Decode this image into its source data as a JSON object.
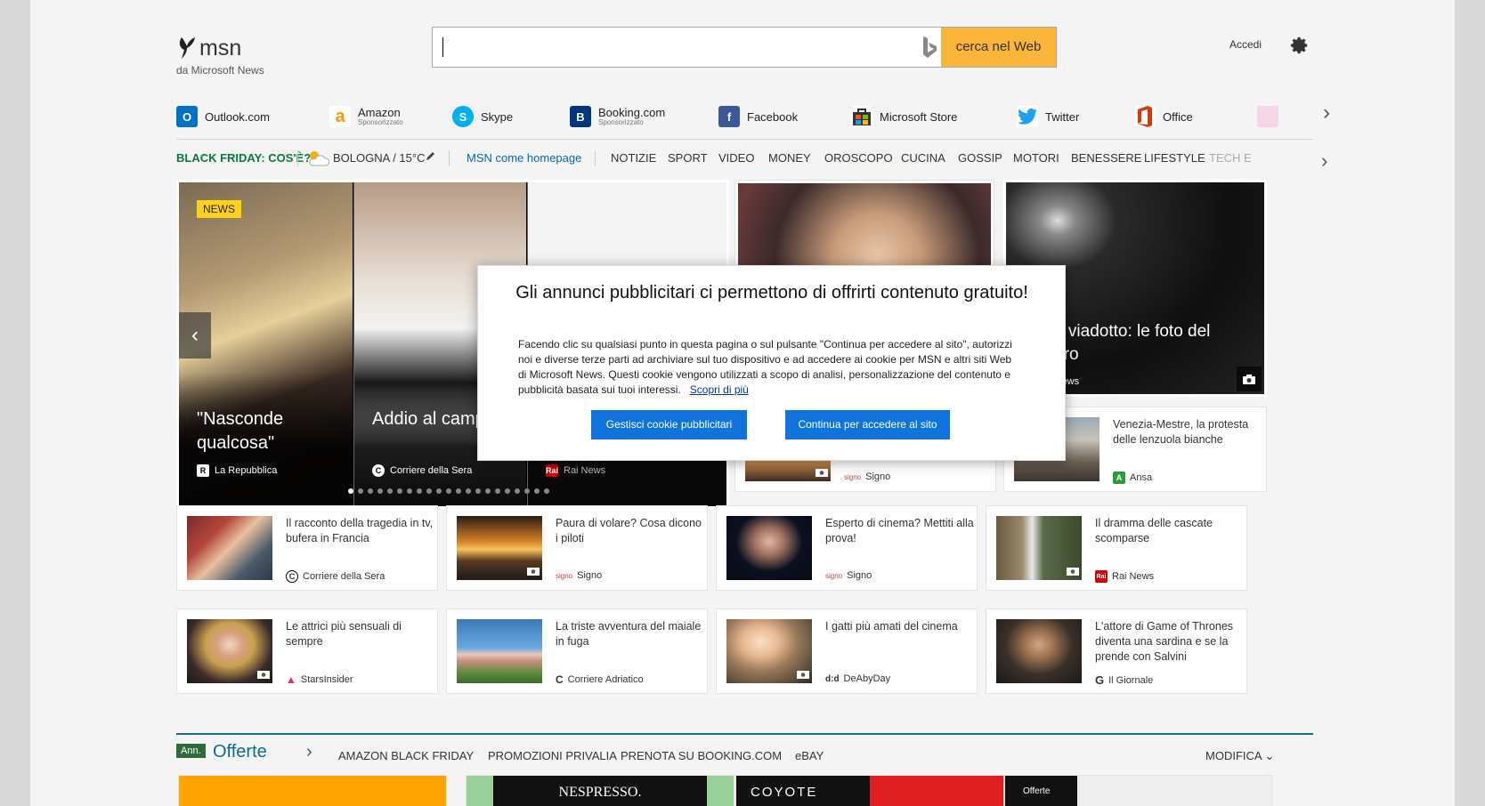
{
  "header": {
    "logo_name": "msn",
    "logo_sub": "da Microsoft News",
    "search_placeholder": "",
    "search_button": "cerca nel Web",
    "signin": "Accedi"
  },
  "quicklinks": [
    {
      "label": "Outlook.com",
      "sponsor": "",
      "color": "#0072c6",
      "glyph": "O"
    },
    {
      "label": "Amazon",
      "sponsor": "Sponsorizzato",
      "color": "#ff9900",
      "glyph": "a"
    },
    {
      "label": "Skype",
      "sponsor": "",
      "color": "#00aff0",
      "glyph": "S"
    },
    {
      "label": "Booking.com",
      "sponsor": "Sponsorizzato",
      "color": "#003580",
      "glyph": "B"
    },
    {
      "label": "Facebook",
      "sponsor": "",
      "color": "#3b5998",
      "glyph": "f"
    },
    {
      "label": "Microsoft Store",
      "sponsor": "",
      "color": "#333333",
      "glyph": "■"
    },
    {
      "label": "Twitter",
      "sponsor": "",
      "color": "#1da1f2",
      "glyph": "t"
    },
    {
      "label": "Office",
      "sponsor": "",
      "color": "#d83b01",
      "glyph": "O"
    }
  ],
  "nav": {
    "blackfriday": "BLACK FRIDAY: COS'È?",
    "weather": "BOLOGNA / 15°C",
    "homepage": "MSN come homepage",
    "categories": [
      "NOTIZIE",
      "SPORT",
      "VIDEO",
      "MONEY",
      "OROSCOPO",
      "CUCINA",
      "GOSSIP",
      "MOTORI",
      "BENESSERE",
      "LIFESTYLE"
    ],
    "fade": "TECH E"
  },
  "hero": {
    "badge": "NEWS",
    "slides": [
      {
        "title": "\"Nasconde qualcosa\"",
        "source": "La Repubblica",
        "icon": "R"
      },
      {
        "title": "Addio al campion",
        "source": "Corriere della Sera",
        "icon": "C"
      },
      {
        "title": "",
        "source": "Rai News",
        "icon": "Rai"
      }
    ],
    "dots": 21
  },
  "bigcard": {
    "title": "Crollo viadotto: le foto del disastro",
    "source": "Rai News"
  },
  "cards": [
    {
      "title": "",
      "source": "Signo",
      "icon": "signo"
    },
    {
      "title": "Venezia-Mestre, la protesta delle lenzuola bianche",
      "source": "Ansa",
      "icon": "A"
    },
    {
      "title": "Il racconto della tragedia in tv, bufera in Francia",
      "source": "Corriere della Sera",
      "icon": "C"
    },
    {
      "title": "Paura di volare? Cosa dicono i piloti",
      "source": "Signo",
      "icon": "signo"
    },
    {
      "title": "Esperto di cinema? Mettiti alla prova!",
      "source": "Signo",
      "icon": "signo"
    },
    {
      "title": "Il dramma delle cascate scomparse",
      "source": "Rai News",
      "icon": "Rai"
    },
    {
      "title": "Le attrici più sensuali di sempre",
      "source": "StarsInsider",
      "icon": "S"
    },
    {
      "title": "La triste avventura del maiale in fuga",
      "source": "Corriere Adriatico",
      "icon": "C"
    },
    {
      "title": "I gatti più amati del cinema",
      "source": "DeAbyDay",
      "icon": "d"
    },
    {
      "title": "L'attore di Game of Thrones diventa una sardina e se la prende con Salvini",
      "source": "Il Giornale",
      "icon": "G"
    }
  ],
  "modal": {
    "title": "Gli annunci pubblicitari ci permettono di offrirti contenuto gratuito!",
    "body": "Facendo clic su qualsiasi punto in questa pagina o sul pulsante \"Continua per accedere al sito\", autorizzi noi e diverse terze parti ad archiviare sul tuo dispositivo e ad accedere ai cookie per MSN e altri siti Web di Microsoft News. Questi cookie vengono utilizzati a scopo di analisi, personalizzazione del contenuto e pubblicità basata sui tuoi interessi.",
    "link": "Scopri di più",
    "manage": "Gestisci cookie pubblicitari",
    "continue": "Continua per accedere al sito"
  },
  "offers": {
    "ann": "Ann.",
    "title": "Offerte",
    "links": [
      "AMAZON BLACK FRIDAY",
      "PROMOZIONI PRIVALIA",
      "PRENOTA SU BOOKING.COM",
      "eBAY"
    ],
    "modify": "MODIFICA",
    "tiles": [
      "",
      "NESPRESSO.",
      "COYOTE",
      "Offerte"
    ]
  }
}
